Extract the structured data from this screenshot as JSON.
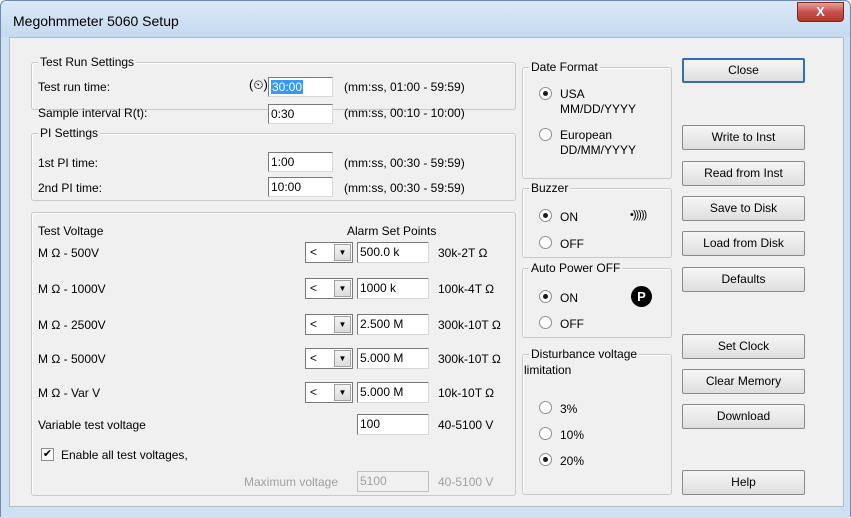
{
  "window": {
    "title": "Megohmmeter 5060 Setup",
    "close_glyph": "X"
  },
  "test_run": {
    "group_title": "Test Run Settings",
    "run_time_label": "Test run time:",
    "run_time_icon": "clock-icon",
    "run_time_value": "30:00",
    "run_time_range": "(mm:ss, 01:00 - 59:59)",
    "sample_label": "Sample interval R(t):",
    "sample_value": "0:30",
    "sample_range": "(mm:ss, 00:10 - 10:00)"
  },
  "pi": {
    "group_title": "PI Settings",
    "pi1_label": "1st PI time:",
    "pi1_value": "1:00",
    "pi1_range": "(mm:ss, 00:30 - 59:59)",
    "pi2_label": "2nd PI time:",
    "pi2_value": "10:00",
    "pi2_range": "(mm:ss, 00:30 - 59:59)"
  },
  "voltage": {
    "header_left": "Test Voltage",
    "header_right": "Alarm Set Points",
    "rows": [
      {
        "label": "M Ω - 500V",
        "op": "<",
        "value": "500.0 k",
        "range": "30k-2T Ω"
      },
      {
        "label": "M Ω - 1000V",
        "op": "<",
        "value": "1000 k",
        "range": "100k-4T Ω"
      },
      {
        "label": "M Ω - 2500V",
        "op": "<",
        "value": "2.500 M",
        "range": "300k-10T Ω"
      },
      {
        "label": "M Ω - 5000V",
        "op": "<",
        "value": "5.000 M",
        "range": "300k-10T Ω"
      },
      {
        "label": "M Ω - Var V",
        "op": "<",
        "value": "5.000 M",
        "range": "10k-10T Ω"
      }
    ],
    "variable_label": "Variable test voltage",
    "variable_value": "100",
    "variable_range": "40-5100 V",
    "enable_label": "Enable all test voltages,",
    "enable_checked": true,
    "max_label": "Maximum voltage",
    "max_value": "5100",
    "max_range": "40-5100 V"
  },
  "date_format": {
    "group_title": "Date Format",
    "usa_label": "USA",
    "usa_format": "MM/DD/YYYY",
    "european_label": "European",
    "european_format": "DD/MM/YYYY",
    "selected": "USA"
  },
  "buzzer": {
    "group_title": "Buzzer",
    "on_label": "ON",
    "off_label": "OFF",
    "icon": "sound-waves-icon",
    "icon_glyph": "•)))))",
    "selected": "ON"
  },
  "auto_power": {
    "group_title": "Auto Power OFF",
    "on_label": "ON",
    "off_label": "OFF",
    "icon": "power-p-icon",
    "icon_glyph": "P",
    "selected": "ON"
  },
  "disturbance": {
    "group_title_line1": "Disturbance voltage",
    "group_title_line2": "limitation",
    "opt1": "3%",
    "opt2": "10%",
    "opt3": "20%",
    "selected": "20%"
  },
  "buttons": {
    "close": "Close",
    "write": "Write to Inst",
    "read": "Read from Inst",
    "save": "Save to Disk",
    "load": "Load from Disk",
    "defaults": "Defaults",
    "set_clock": "Set Clock",
    "clear_memory": "Clear Memory",
    "download": "Download",
    "help": "Help"
  },
  "colors": {
    "selection": "#3399ff",
    "window_frame": "#cfe0f3",
    "close_button": "#c75050"
  }
}
